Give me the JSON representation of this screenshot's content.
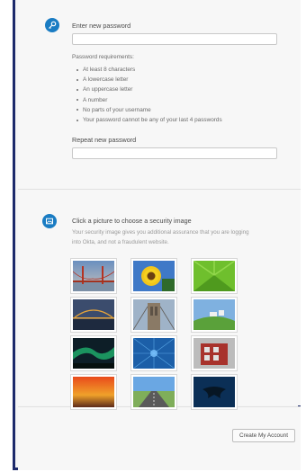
{
  "new_password": {
    "label": "Enter new password",
    "value": "",
    "requirements_title": "Password requirements:",
    "requirements": [
      "At least 8 characters",
      "A lowercase letter",
      "An uppercase letter",
      "A number",
      "No parts of your username",
      "Your password cannot be any of your last 4 passwords"
    ]
  },
  "repeat_password": {
    "label": "Repeat new password",
    "value": ""
  },
  "security_image": {
    "title": "Click a picture to choose a security image",
    "description": "Your security image gives you additional assurance that you are logging into Okta, and not a fraudulent website.",
    "images": [
      {
        "name": "golden-gate-bridge"
      },
      {
        "name": "sunflower"
      },
      {
        "name": "green-fern"
      },
      {
        "name": "bridge-at-night"
      },
      {
        "name": "brooklyn-bridge"
      },
      {
        "name": "goats-on-hill"
      },
      {
        "name": "northern-lights"
      },
      {
        "name": "blue-network"
      },
      {
        "name": "red-building"
      },
      {
        "name": "sunset-sky"
      },
      {
        "name": "open-road"
      },
      {
        "name": "manta-ray"
      }
    ]
  },
  "footer": {
    "create_label": "Create My Account"
  },
  "colors": {
    "accent": "#1a7cc3",
    "frame_border": "#1d2a6b"
  }
}
